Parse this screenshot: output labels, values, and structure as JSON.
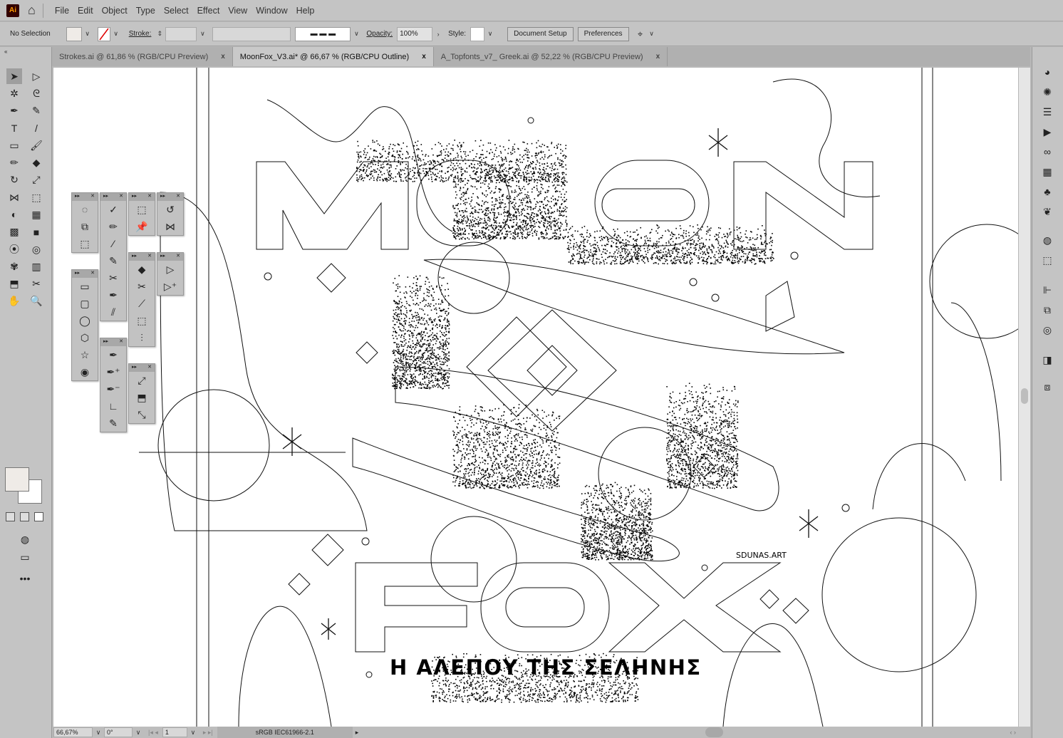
{
  "app": {
    "logo": "Ai",
    "menus": [
      "File",
      "Edit",
      "Object",
      "Type",
      "Select",
      "Effect",
      "View",
      "Window",
      "Help"
    ]
  },
  "control": {
    "selection": "No Selection",
    "stroke_label": "Stroke:",
    "opacity_label": "Opacity:",
    "opacity_value": "100%",
    "style_label": "Style:",
    "document_setup": "Document Setup",
    "preferences": "Preferences",
    "fill_color": "#efebe7"
  },
  "tabs": [
    {
      "label": "Strokes.ai @ 61,86 % (RGB/CPU Preview)",
      "active": false
    },
    {
      "label": "MoonFox_V3.ai* @ 66,67 % (RGB/CPU Outline)",
      "active": true
    },
    {
      "label": "A_Topfonts_v7_ Greek.ai @ 52,22 % (RGB/CPU Preview)",
      "active": false
    }
  ],
  "tab_close": "x",
  "tools": [
    "selection",
    "direct-selection",
    "magic-wand",
    "lasso",
    "pen",
    "curvature",
    "type",
    "line",
    "rectangle",
    "paintbrush",
    "pencil",
    "eraser",
    "rotate",
    "scale",
    "width",
    "free-transform",
    "shape-builder",
    "perspective-grid",
    "mesh",
    "gradient",
    "eyedropper",
    "blend",
    "symbol-sprayer",
    "column-graph",
    "artboard",
    "slice",
    "hand",
    "zoom"
  ],
  "artwork": {
    "subtitle": "Η ΑΛΕΠΟΥ ΤΗΣ ΣΕΛΗΝΗΣ",
    "signature": "SDUNAS.ART",
    "title_top": "MOON",
    "title_bottom": "FOX"
  },
  "status": {
    "zoom": "66,67%",
    "rotation": "0°",
    "artboard": "1",
    "profile": "sRGB IEC61966-2.1"
  }
}
